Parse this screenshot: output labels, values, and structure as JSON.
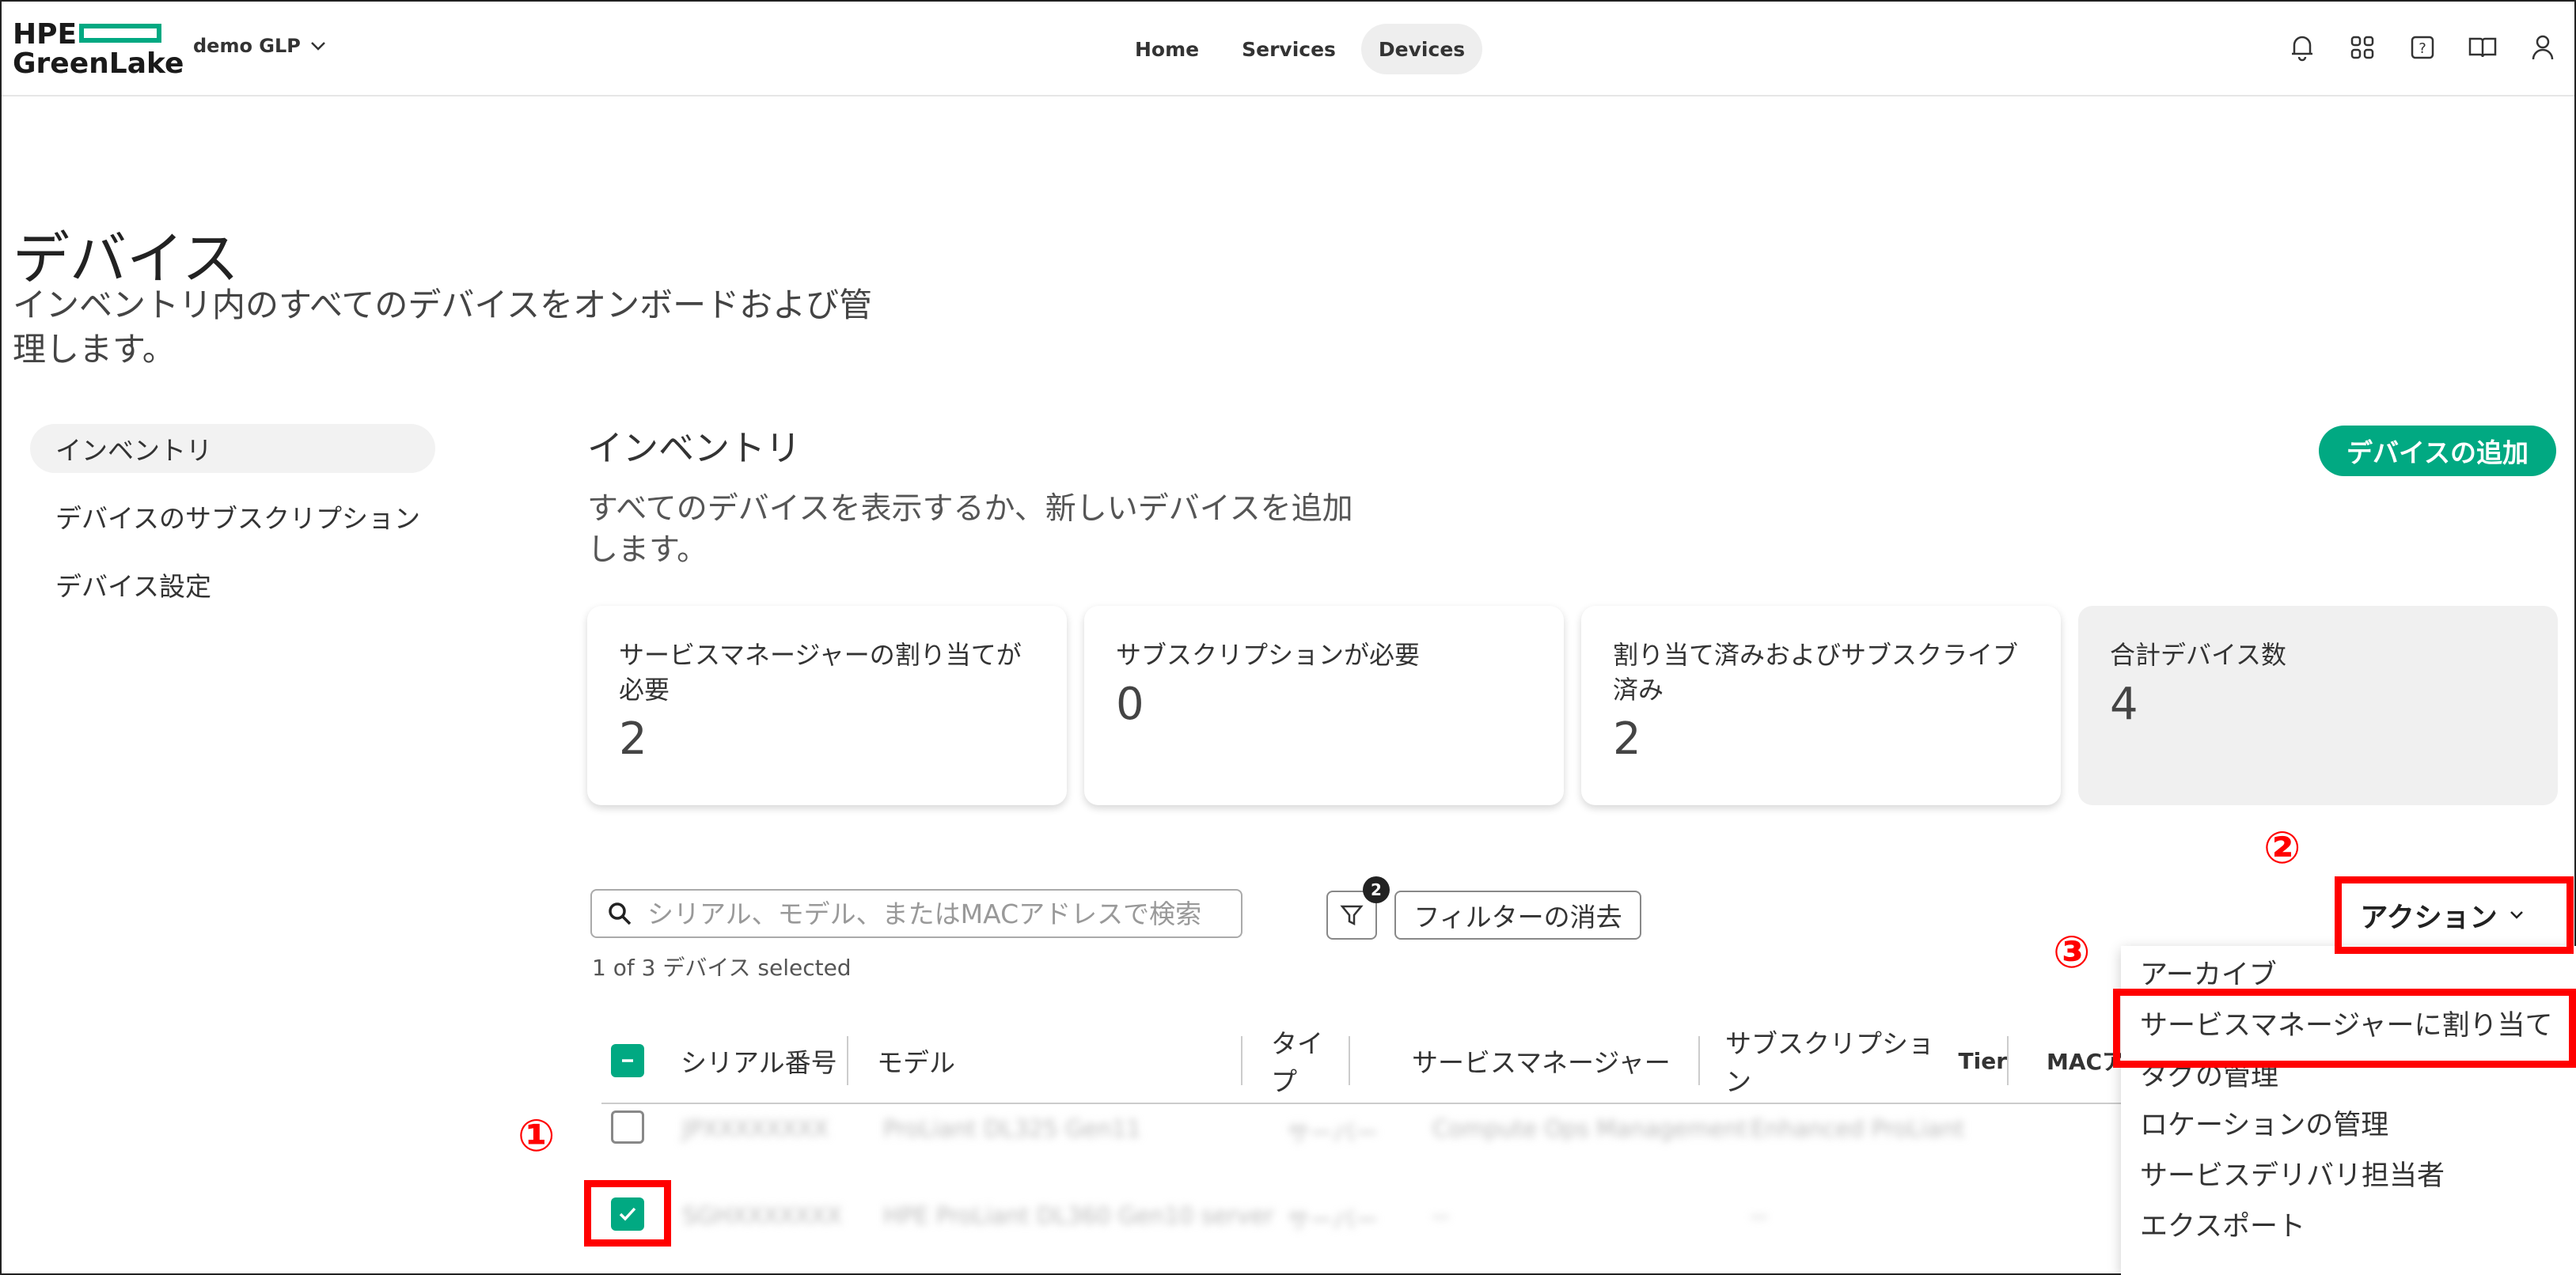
{
  "header": {
    "logo_top": "HPE",
    "logo_bottom": "GreenLake",
    "workspace": "demo GLP",
    "nav": [
      "Home",
      "Services",
      "Devices"
    ],
    "active_nav": "Devices",
    "brand_color": "#01a982"
  },
  "page": {
    "title": "デバイス",
    "description": "インベントリ内のすべてのデバイスをオンボードおよび管理します。"
  },
  "sidebar": {
    "items": [
      {
        "label": "インベントリ",
        "active": true
      },
      {
        "label": "デバイスのサブスクリプション",
        "active": false
      },
      {
        "label": "デバイス設定",
        "active": false
      }
    ]
  },
  "inventory": {
    "title": "インベントリ",
    "description": "すべてのデバイスを表示するか、新しいデバイスを追加します。",
    "add_button": "デバイスの追加"
  },
  "cards": [
    {
      "label": "サービスマネージャーの割り当てが必要",
      "value": "2"
    },
    {
      "label": "サブスクリプションが必要",
      "value": "0"
    },
    {
      "label": "割り当て済みおよびサブスクライブ済み",
      "value": "2"
    },
    {
      "label": "合計デバイス数",
      "value": "4"
    }
  ],
  "toolbar": {
    "search_placeholder": "シリアル、モデル、またはMACアドレスで検索",
    "filter_count": "2",
    "clear_filters": "フィルターの消去",
    "selected_text": "1 of 3 デバイス selected",
    "actions_label": "アクション"
  },
  "table": {
    "columns": [
      "シリアル番号",
      "モデル",
      "タイプ",
      "サービスマネージャー",
      "サブスクリプション",
      "MACア"
    ],
    "tier_suffix": "Tier",
    "rows": [
      {
        "checked": false,
        "serial": "JPXXXXXXXX",
        "model": "ProLiant DL325 Gen11",
        "type": "サーバー",
        "manager": "Compute Ops Management",
        "subscription": "Enhanced ProLiant"
      },
      {
        "checked": true,
        "serial": "SGHXXXXXXX",
        "model": "HPE ProLiant DL360 Gen10 server",
        "type": "サーバー",
        "manager": "--",
        "subscription": "--"
      }
    ]
  },
  "action_menu": {
    "items": [
      "アーカイブ",
      "サービスマネージャーに割り当て",
      "タグの管理",
      "ロケーションの管理",
      "サービスデリバリ担当者",
      "エクスポート"
    ]
  },
  "annotations": {
    "step1": "①",
    "step2": "②",
    "step3": "③",
    "color": "#ff0000"
  }
}
